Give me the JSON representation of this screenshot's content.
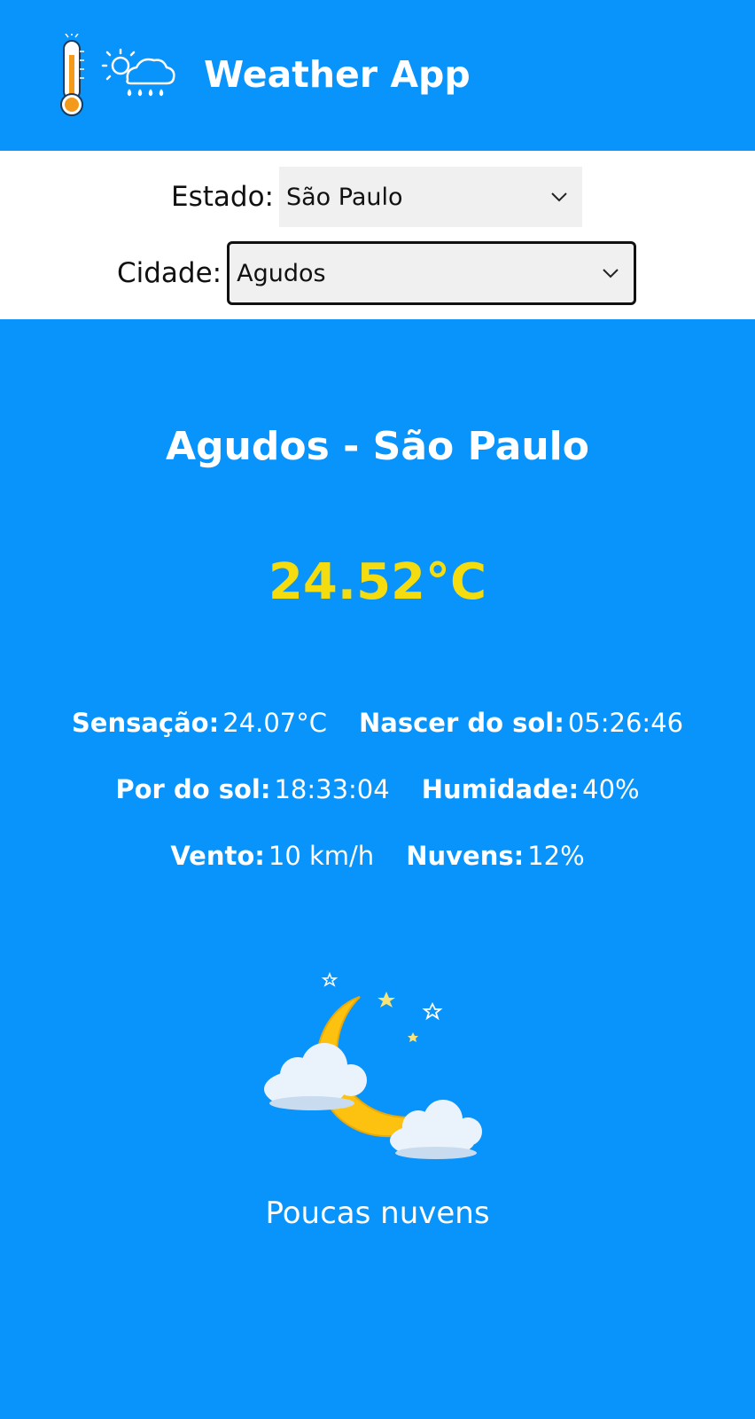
{
  "header": {
    "title": "Weather App",
    "thermometer_icon": "thermometer-icon",
    "weather_icon": "sun-cloud-rain-icon"
  },
  "selectors": {
    "estado_label": "Estado:",
    "estado_value": "São Paulo",
    "cidade_label": "Cidade:",
    "cidade_value": "Agudos"
  },
  "weather": {
    "location": "Agudos - São Paulo",
    "temperature": "24.52°C",
    "details": [
      {
        "label": "Sensação:",
        "value": "24.07°C"
      },
      {
        "label": "Nascer do sol:",
        "value": "05:26:46"
      },
      {
        "label": "Por do sol:",
        "value": "18:33:04"
      },
      {
        "label": "Humidade:",
        "value": "40%"
      },
      {
        "label": "Vento:",
        "value": "10 km/h"
      },
      {
        "label": "Nuvens:",
        "value": "12%"
      }
    ],
    "icon": "moon-clouds-icon",
    "description": "Poucas nuvens"
  },
  "colors": {
    "background": "#0894fb",
    "temperature": "#f5dc0f",
    "moon": "#fdc10f",
    "cloud": "#e8f1fb"
  }
}
